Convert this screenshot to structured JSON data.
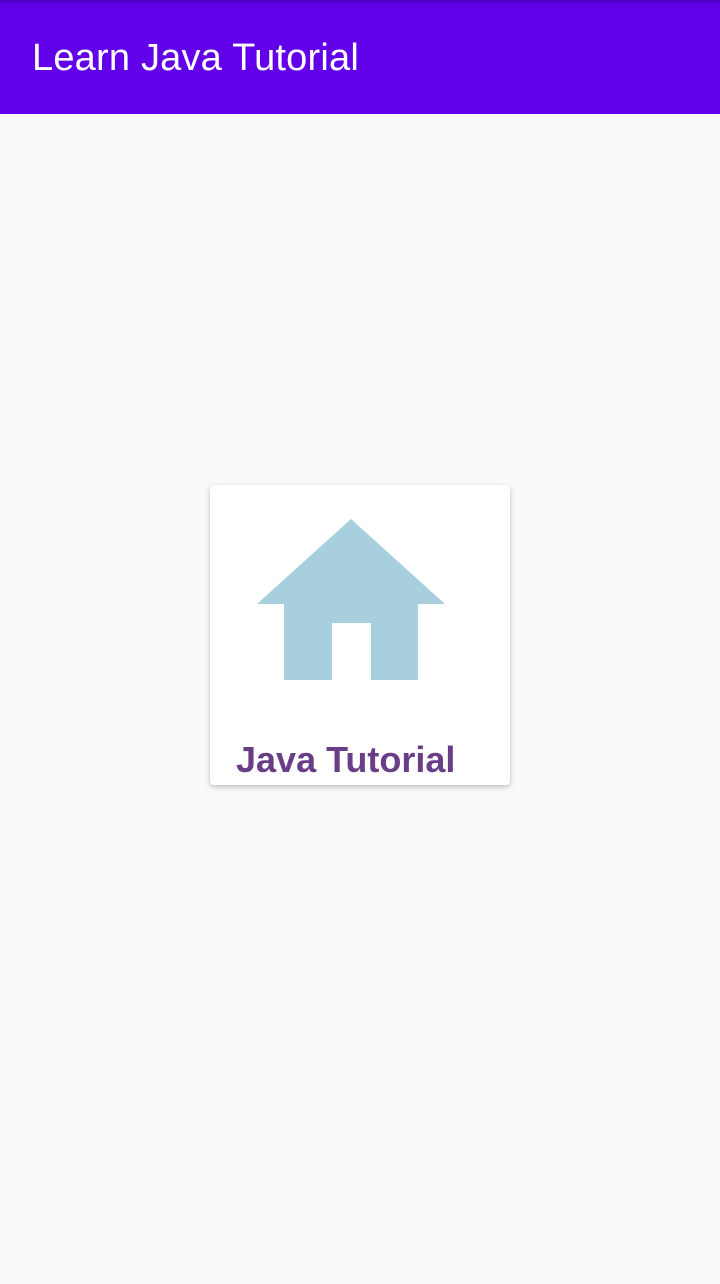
{
  "app_bar": {
    "title": "Learn Java Tutorial",
    "background_color": "#6200ea"
  },
  "card": {
    "icon": "home-icon",
    "icon_color": "#a8cfdd",
    "label": "Java Tutorial",
    "label_color": "#6a3d87"
  }
}
